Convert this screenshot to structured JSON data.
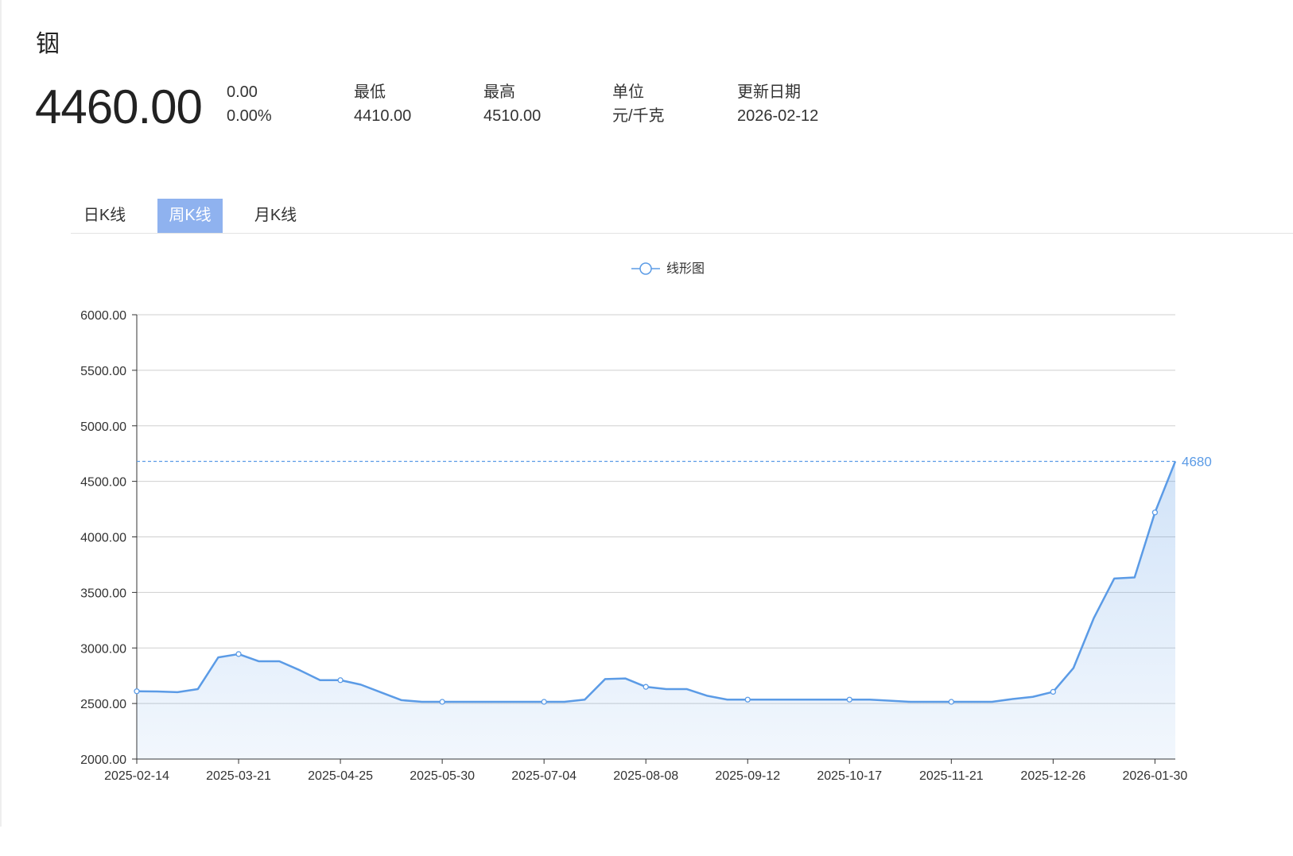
{
  "header": {
    "title": "铟",
    "price": "4460.00",
    "change": "0.00",
    "change_pct": "0.00%",
    "stats": [
      {
        "label": "最低",
        "value": "4410.00"
      },
      {
        "label": "最高",
        "value": "4510.00"
      },
      {
        "label": "单位",
        "value": "元/千克"
      },
      {
        "label": "更新日期",
        "value": "2026-02-12"
      }
    ]
  },
  "tabs": [
    {
      "label": "日K线",
      "active": false
    },
    {
      "label": "周K线",
      "active": true
    },
    {
      "label": "月K线",
      "active": false
    }
  ],
  "colors": {
    "line": "#5b9be6",
    "accent_tab": "#8fb2ef"
  },
  "chart_data": {
    "type": "line",
    "legend": [
      "线形图"
    ],
    "legend_position": "top-center",
    "grid": true,
    "ylim": [
      2000,
      6000
    ],
    "yticks": [
      "2000.00",
      "2500.00",
      "3000.00",
      "3500.00",
      "4000.00",
      "4500.00",
      "5000.00",
      "5500.00",
      "6000.00"
    ],
    "xticks": [
      "2025-02-14",
      "2025-03-21",
      "2025-04-25",
      "2025-05-30",
      "2025-07-04",
      "2025-08-08",
      "2025-09-12",
      "2025-10-17",
      "2025-11-21",
      "2025-12-26",
      "2026-01-30"
    ],
    "markline_value": 4680,
    "markline_label": "4680",
    "series": [
      {
        "values": [
          2610,
          2608,
          2602,
          2630,
          2915,
          2945,
          2880,
          2880,
          2800,
          2710,
          2710,
          2670,
          2600,
          2530,
          2515,
          2515,
          2515,
          2515,
          2515,
          2515,
          2515,
          2515,
          2535,
          2720,
          2725,
          2650,
          2630,
          2630,
          2570,
          2535,
          2535,
          2535,
          2535,
          2535,
          2535,
          2535,
          2535,
          2525,
          2515,
          2515,
          2515,
          2515,
          2515,
          2540,
          2560,
          2605,
          2820,
          3270,
          3625,
          3635,
          4220,
          4680
        ]
      }
    ]
  }
}
